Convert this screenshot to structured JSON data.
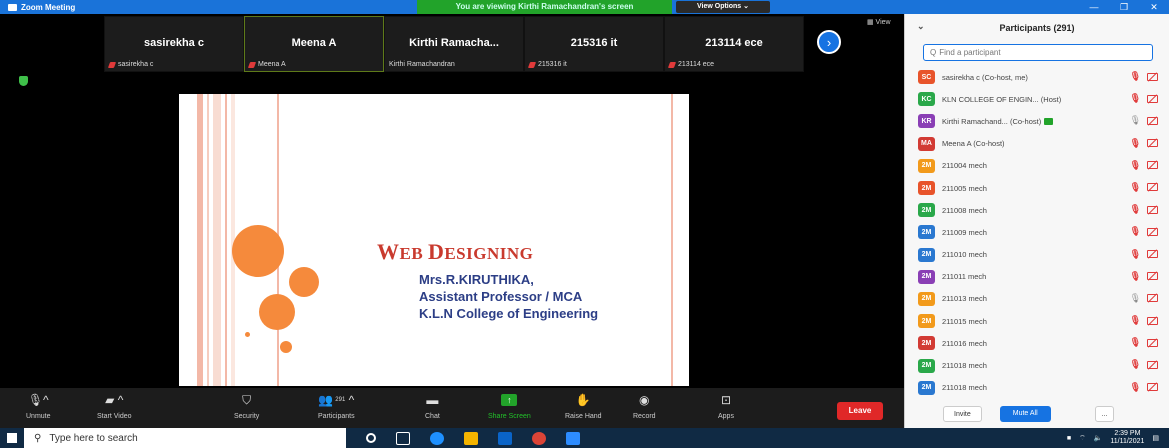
{
  "window": {
    "title": "Zoom Meeting"
  },
  "banner": {
    "viewing": "You are viewing Kirthi Ramachandran's screen",
    "view_options": "View Options ⌄"
  },
  "window_controls": {
    "minimize": "—",
    "maximize": "❐",
    "close": "✕"
  },
  "video_tiles": [
    {
      "name": "sasirekha c",
      "label": "sasirekha c",
      "muted": true
    },
    {
      "name": "Meena A",
      "label": "Meena A",
      "muted": true
    },
    {
      "name": "Kirthi Ramacha...",
      "label": "Kirthi Ramachandran",
      "muted": false
    },
    {
      "name": "215316 it",
      "label": "215316 it",
      "muted": true
    },
    {
      "name": "213114 ece",
      "label": "213114 ece",
      "muted": true
    }
  ],
  "view_button": "▦ View",
  "slide": {
    "title_w": "W",
    "title_rest1": "EB ",
    "title_d": "D",
    "title_rest2": "ESIGNING",
    "lines": [
      "Mrs.R.KIRUTHIKA,",
      "Assistant Professor / MCA",
      "K.L.N College of Engineering"
    ]
  },
  "toolbar": {
    "unmute": "Unmute",
    "start_video": "Start Video",
    "security": "Security",
    "participants": "Participants",
    "participants_count": "291",
    "chat": "Chat",
    "share_screen": "Share Screen",
    "raise_hand": "Raise Hand",
    "record": "Record",
    "apps": "Apps",
    "leave": "Leave"
  },
  "panel": {
    "title": "Participants (291)",
    "search_placeholder": "Find a participant",
    "participants": [
      {
        "initials": "SC",
        "color": "#e8542b",
        "name": "sasirekha c (Co-host, me)",
        "mic": "muted"
      },
      {
        "initials": "KC",
        "color": "#2aa84a",
        "name": "KLN COLLEGE OF ENGIN... (Host)",
        "mic": "muted"
      },
      {
        "initials": "KR",
        "color": "#8a3fb5",
        "name": "Kirthi Ramachand... (Co-host)",
        "mic": "on",
        "sharing": true
      },
      {
        "initials": "MA",
        "color": "#d23b34",
        "name": "Meena A (Co-host)",
        "mic": "muted"
      },
      {
        "initials": "2M",
        "color": "#f29a1b",
        "name": "211004 mech",
        "mic": "muted"
      },
      {
        "initials": "2M",
        "color": "#e8542b",
        "name": "211005 mech",
        "mic": "muted"
      },
      {
        "initials": "2M",
        "color": "#2aa84a",
        "name": "211008 mech",
        "mic": "muted"
      },
      {
        "initials": "2M",
        "color": "#2a78d0",
        "name": "211009 mech",
        "mic": "muted"
      },
      {
        "initials": "2M",
        "color": "#2a78d0",
        "name": "211010 mech",
        "mic": "muted"
      },
      {
        "initials": "2M",
        "color": "#8a3fb5",
        "name": "211011 mech",
        "mic": "muted"
      },
      {
        "initials": "2M",
        "color": "#f29a1b",
        "name": "211013 mech",
        "mic": "on"
      },
      {
        "initials": "2M",
        "color": "#f29a1b",
        "name": "211015 mech",
        "mic": "muted"
      },
      {
        "initials": "2M",
        "color": "#d23b34",
        "name": "211016 mech",
        "mic": "muted"
      },
      {
        "initials": "2M",
        "color": "#2aa84a",
        "name": "211018 mech",
        "mic": "muted"
      },
      {
        "initials": "2M",
        "color": "#2a78d0",
        "name": "211018 mech",
        "mic": "muted"
      }
    ],
    "invite": "Invite",
    "mute_all": "Mute All",
    "more": "..."
  },
  "taskbar": {
    "search_placeholder": "Type here to search",
    "time": "2:39 PM",
    "date": "11/11/2021"
  }
}
